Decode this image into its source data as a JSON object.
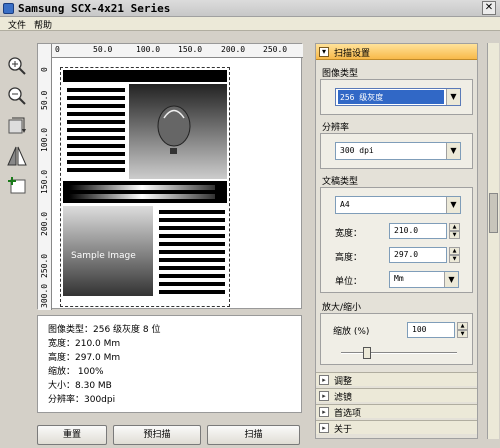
{
  "window": {
    "title": "Samsung SCX-4x21 Series"
  },
  "menu": [
    "文件",
    "帮助"
  ],
  "toolbar": [
    "zoom-in-icon",
    "zoom-out-icon",
    "rotate-icon",
    "flip-icon",
    "add-scan-icon"
  ],
  "ruler": {
    "top": [
      "0",
      "50.0",
      "100.0",
      "150.0",
      "200.0",
      "250.0"
    ],
    "left": [
      "0",
      "50.0",
      "100.0",
      "150.0",
      "200.0",
      "250.0",
      "300.0"
    ]
  },
  "preview": {
    "sample_text": "Sample Image"
  },
  "info": {
    "image_type": "图像类型：256 级灰度 8 位",
    "width": "宽度：210.0 Mm",
    "height": "高度：297.0 Mm",
    "zoom": "缩放： 100%",
    "size": "大小：8.30 MB",
    "resolution": "分辨率：300dpi"
  },
  "buttons": {
    "reset": "重置",
    "prescan": "预扫描",
    "scan": "扫描"
  },
  "panel": {
    "header": "扫描设置",
    "image_type_label": "图像类型",
    "image_type_value": "256 级灰度",
    "resolution_label": "分辨率",
    "resolution_value": "300 dpi",
    "doc_type_label": "文稿类型",
    "doc_type_value": "A4",
    "width_label": "宽度：",
    "width_value": "210.0",
    "height_label": "高度：",
    "height_value": "297.0",
    "unit_label": "单位：",
    "unit_value": "Mm",
    "scale_label": "放大/缩小",
    "zoom_label": "缩放 (%)",
    "zoom_value": "100",
    "slider_level": 0.2
  },
  "collapsed_sections": [
    "调整",
    "滤镜",
    "首选项",
    "关于"
  ]
}
